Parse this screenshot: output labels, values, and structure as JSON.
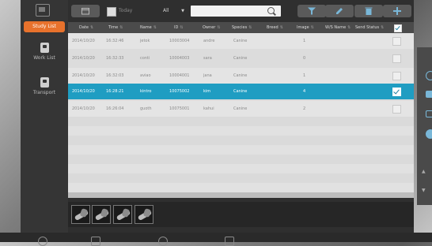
{
  "sidebar": {
    "study_list": "Study List",
    "work_list": "Work List",
    "transport": "Transport"
  },
  "toolbar": {
    "today_label": "Today",
    "filter_value": "All"
  },
  "table": {
    "columns": [
      "Date",
      "Time",
      "Name",
      "ID",
      "Owner",
      "Species",
      "Breed",
      "Image",
      "W/S Name",
      "Send Status"
    ],
    "rows": [
      {
        "date": "2014/10/20",
        "time": "16:32:46",
        "name": "jetok",
        "id": "10003004",
        "owner": "andre",
        "species": "Canine",
        "breed": "",
        "image": "1",
        "ws": "",
        "status": "",
        "selected": false
      },
      {
        "date": "2014/10/20",
        "time": "16:32:33",
        "name": "conti",
        "id": "10004003",
        "owner": "sara",
        "species": "Canine",
        "breed": "",
        "image": "0",
        "ws": "",
        "status": "",
        "selected": false
      },
      {
        "date": "2014/10/20",
        "time": "16:32:03",
        "name": "aviao",
        "id": "10004001",
        "owner": "jana",
        "species": "Canine",
        "breed": "",
        "image": "1",
        "ws": "",
        "status": "",
        "selected": false
      },
      {
        "date": "2014/10/20",
        "time": "16:28:21",
        "name": "kintro",
        "id": "10075002",
        "owner": "kim",
        "species": "Canine",
        "breed": "",
        "image": "4",
        "ws": "",
        "status": "",
        "selected": true
      },
      {
        "date": "2014/10/20",
        "time": "16:26:04",
        "name": "guoth",
        "id": "10075001",
        "owner": "kahui",
        "species": "Canine",
        "breed": "",
        "image": "2",
        "ws": "",
        "status": "",
        "selected": false
      }
    ]
  },
  "colors": {
    "accent_orange": "#e8722c",
    "selected_row": "#1f9dc2"
  }
}
